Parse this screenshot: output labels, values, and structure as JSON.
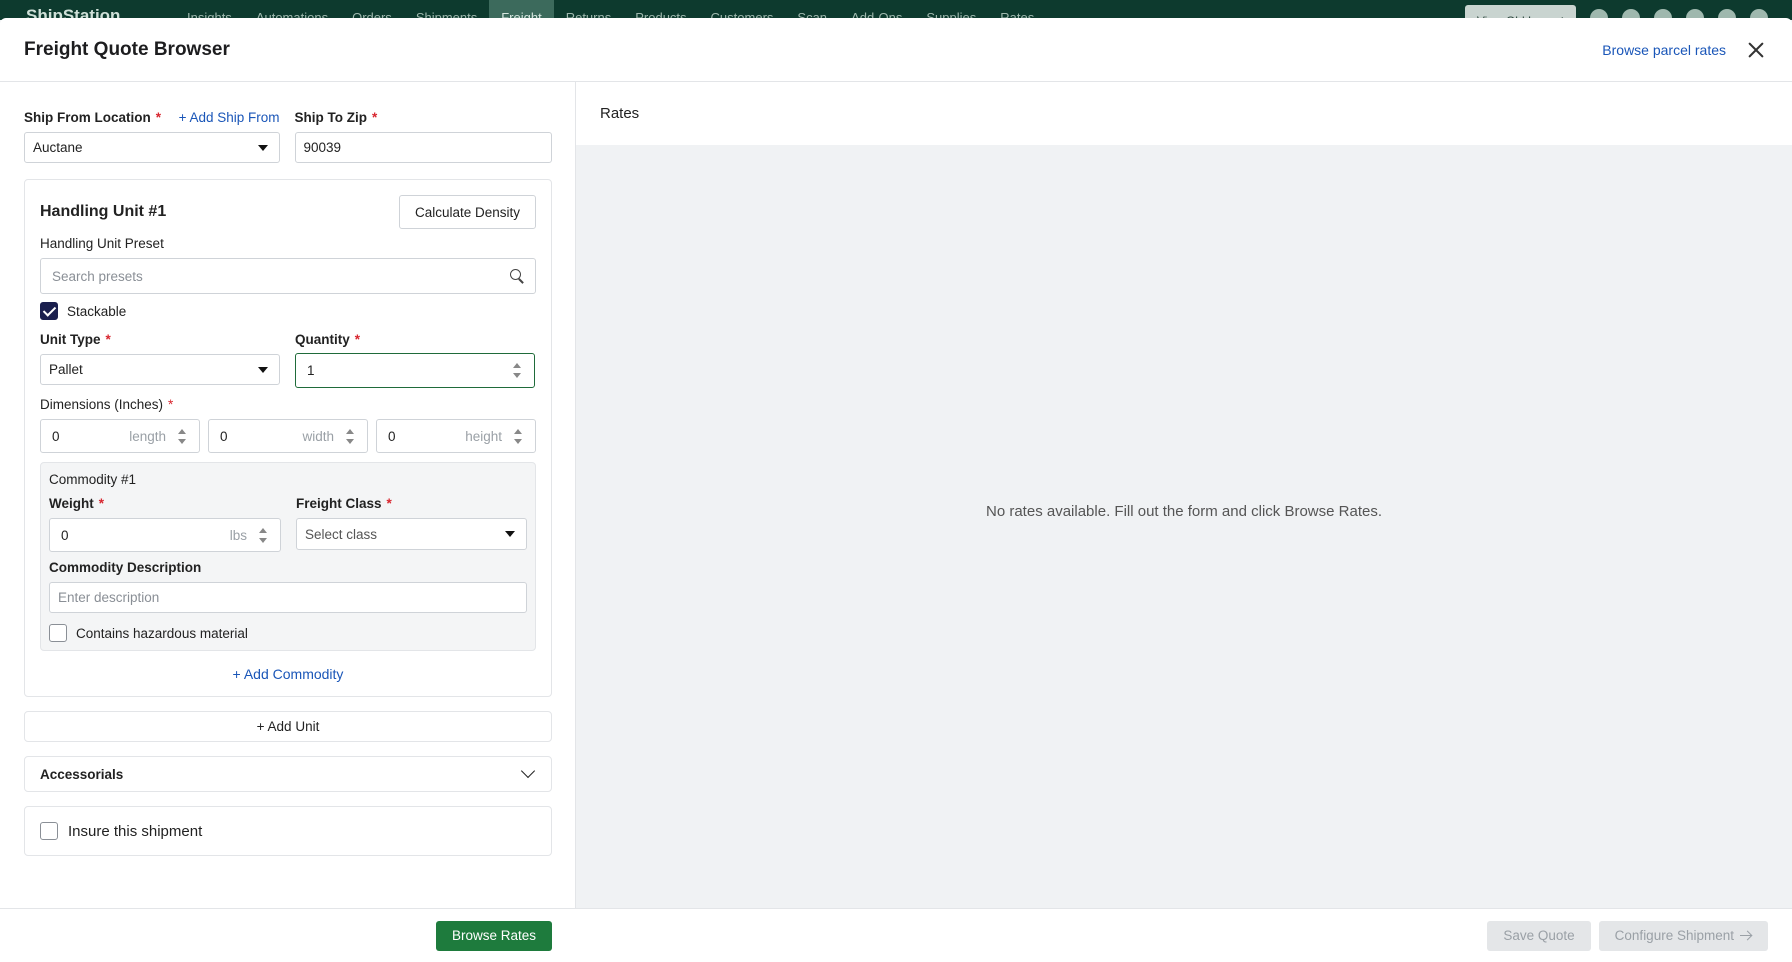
{
  "background_nav": {
    "brand": "ShipStation",
    "items": [
      "Insights",
      "Automations",
      "Orders",
      "Shipments",
      "Freight",
      "Returns",
      "Products",
      "Customers",
      "Scan",
      "Add-Ons",
      "Supplies",
      "Rates"
    ],
    "active_item": "Freight",
    "old_layout_label": "View Old Layout"
  },
  "modal": {
    "title": "Freight Quote Browser",
    "browse_parcel_link": "Browse parcel rates"
  },
  "form": {
    "ship_from": {
      "label": "Ship From Location",
      "required": "*",
      "add_link": "+ Add Ship From",
      "value": "Auctane"
    },
    "ship_to": {
      "label": "Ship To Zip",
      "required": "*",
      "value": "90039"
    },
    "handling_unit": {
      "title": "Handling Unit #1",
      "calc_density_label": "Calculate Density",
      "preset_label": "Handling Unit Preset",
      "preset_placeholder": "Search presets",
      "stackable_label": "Stackable",
      "stackable_checked": true,
      "unit_type": {
        "label": "Unit Type",
        "required": "*",
        "value": "Pallet"
      },
      "quantity": {
        "label": "Quantity",
        "required": "*",
        "value": "1"
      },
      "dimensions": {
        "label": "Dimensions (Inches)",
        "required": "*",
        "length": {
          "value": "0",
          "suffix": "length"
        },
        "width": {
          "value": "0",
          "suffix": "width"
        },
        "height": {
          "value": "0",
          "suffix": "height"
        }
      },
      "commodity": {
        "title": "Commodity #1",
        "weight": {
          "label": "Weight",
          "required": "*",
          "value": "0",
          "suffix": "lbs"
        },
        "freight_class": {
          "label": "Freight Class",
          "required": "*",
          "placeholder": "Select class"
        },
        "description": {
          "label": "Commodity Description",
          "placeholder": "Enter description"
        },
        "hazardous_label": "Contains hazardous material",
        "hazardous_checked": false
      },
      "add_commodity_label": "+ Add Commodity"
    },
    "add_unit_label": "+ Add Unit",
    "accessorials_label": "Accessorials",
    "insure_label": "Insure this shipment",
    "insure_checked": false
  },
  "rates": {
    "heading": "Rates",
    "empty_message": "No rates available. Fill out the form and click Browse Rates."
  },
  "footer": {
    "browse_rates_label": "Browse Rates",
    "save_quote_label": "Save Quote",
    "configure_label": "Configure Shipment"
  },
  "colors": {
    "primary_button": "#1e7b3d",
    "link": "#1a56b8",
    "checkbox_checked": "#1a1f4e",
    "required_mark": "#d8262f",
    "nav_background": "#0d3a2e"
  }
}
